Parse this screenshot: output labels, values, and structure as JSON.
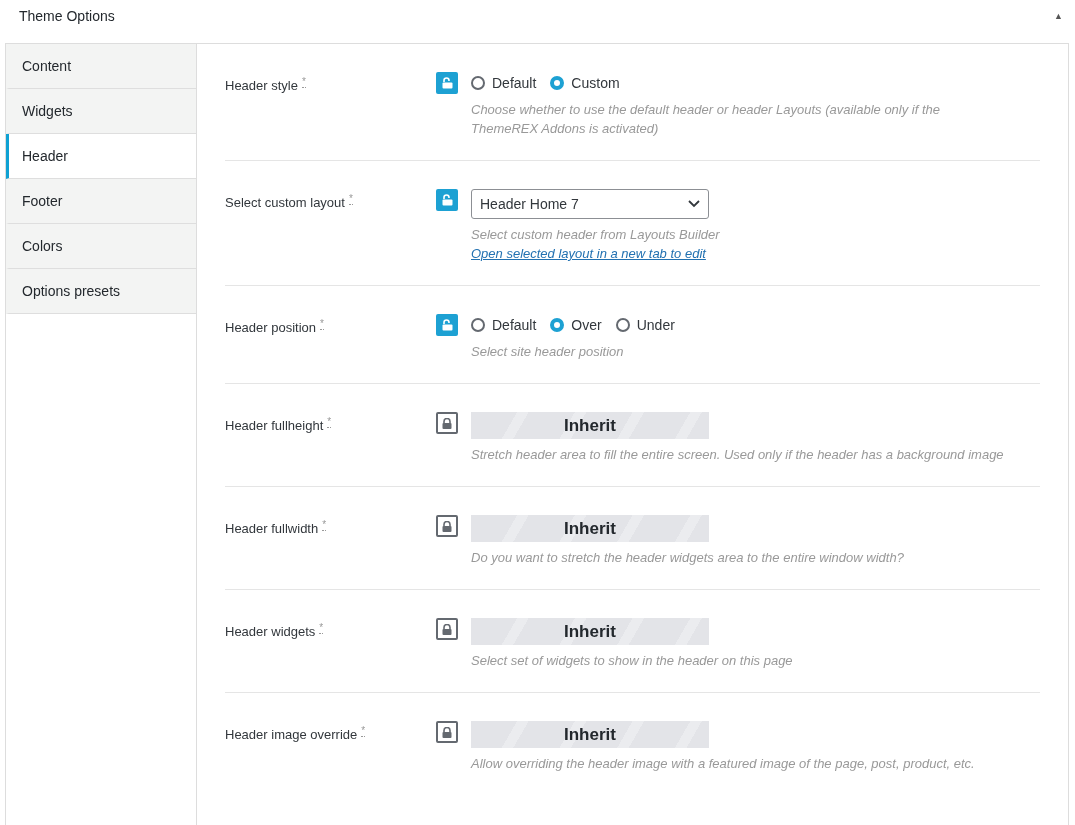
{
  "panel": {
    "title": "Theme Options",
    "collapse_icon": "▲"
  },
  "tabs": [
    {
      "label": "Content",
      "selected": false
    },
    {
      "label": "Widgets",
      "selected": false
    },
    {
      "label": "Header",
      "selected": true
    },
    {
      "label": "Footer",
      "selected": false
    },
    {
      "label": "Colors",
      "selected": false
    },
    {
      "label": "Options presets",
      "selected": false
    }
  ],
  "options": [
    {
      "label": "Header style",
      "marker": "*",
      "locked": false,
      "kind": "radio",
      "choices": [
        {
          "label": "Default",
          "selected": false
        },
        {
          "label": "Custom",
          "selected": true
        }
      ],
      "hint": "Choose whether to use the default header or header Layouts (available only if the ThemeREX Addons is activated)"
    },
    {
      "label": "Select custom layout",
      "marker": "*",
      "locked": false,
      "kind": "select",
      "value": "Header Home 7",
      "hint": "Select custom header from Layouts Builder",
      "link": "Open selected layout in a new tab to edit"
    },
    {
      "label": "Header position",
      "marker": "*",
      "locked": false,
      "kind": "radio",
      "choices": [
        {
          "label": "Default",
          "selected": false
        },
        {
          "label": "Over",
          "selected": true
        },
        {
          "label": "Under",
          "selected": false
        }
      ],
      "hint": "Select site header position"
    },
    {
      "label": "Header fullheight",
      "marker": "*",
      "locked": true,
      "kind": "inherit",
      "value": "Inherit",
      "hint": "Stretch header area to fill the entire screen. Used only if the header has a background image"
    },
    {
      "label": "Header fullwidth",
      "marker": "*",
      "locked": true,
      "kind": "inherit",
      "value": "Inherit",
      "hint": "Do you want to stretch the header widgets area to the entire window width?"
    },
    {
      "label": "Header widgets",
      "marker": "*",
      "locked": true,
      "kind": "inherit",
      "value": "Inherit",
      "hint": "Select set of widgets to show in the header on this page"
    },
    {
      "label": "Header image override",
      "marker": "*",
      "locked": true,
      "kind": "inherit",
      "value": "Inherit",
      "hint": "Allow overriding the header image with a featured image of the page, post, product, etc."
    }
  ]
}
